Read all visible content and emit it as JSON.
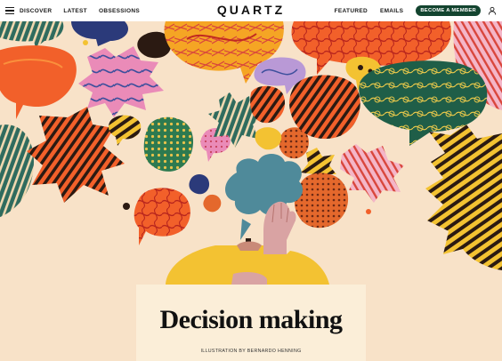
{
  "header": {
    "logo": "QUARTZ",
    "nav_left": [
      "DISCOVER",
      "LATEST",
      "OBSESSIONS"
    ],
    "nav_right": [
      "FEATURED",
      "EMAILS"
    ],
    "cta": "BECOME A MEMBER",
    "menu_icon": "hamburger-icon",
    "account_icon": "user-icon"
  },
  "article": {
    "title": "Decision making",
    "credit": "ILLUSTRATION BY BERNARDO HENNING"
  },
  "colors": {
    "background": "#f8e2c8",
    "brand_green": "#13442f",
    "orange": "#f2602a",
    "pink": "#ea8bb8",
    "teal": "#4f8a9a",
    "yellow": "#f3c232",
    "dark_green": "#1f5e48"
  }
}
